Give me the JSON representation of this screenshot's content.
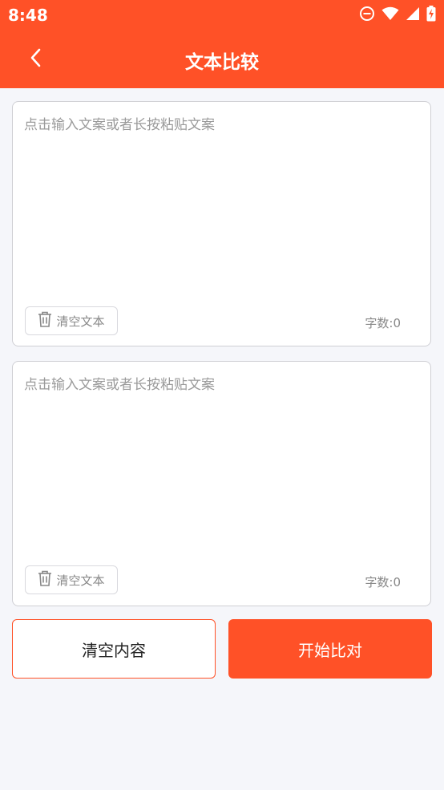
{
  "status_bar": {
    "time": "8:48",
    "icons": [
      "do-not-disturb-icon",
      "wifi-icon",
      "signal-icon",
      "battery-charging-icon"
    ]
  },
  "header": {
    "title": "文本比较",
    "back_icon": "chevron-left-icon"
  },
  "colors": {
    "accent": "#ff5127",
    "background": "#f5f6fa",
    "card": "#ffffff"
  },
  "inputs": [
    {
      "value": "",
      "placeholder": "点击输入文案或者长按粘贴文案",
      "clear_label": "清空文本",
      "count_label": "字数:",
      "count": "0"
    },
    {
      "value": "",
      "placeholder": "点击输入文案或者长按粘贴文案",
      "clear_label": "清空文本",
      "count_label": "字数:",
      "count": "0"
    }
  ],
  "actions": {
    "clear_all": "清空内容",
    "start_compare": "开始比对"
  }
}
